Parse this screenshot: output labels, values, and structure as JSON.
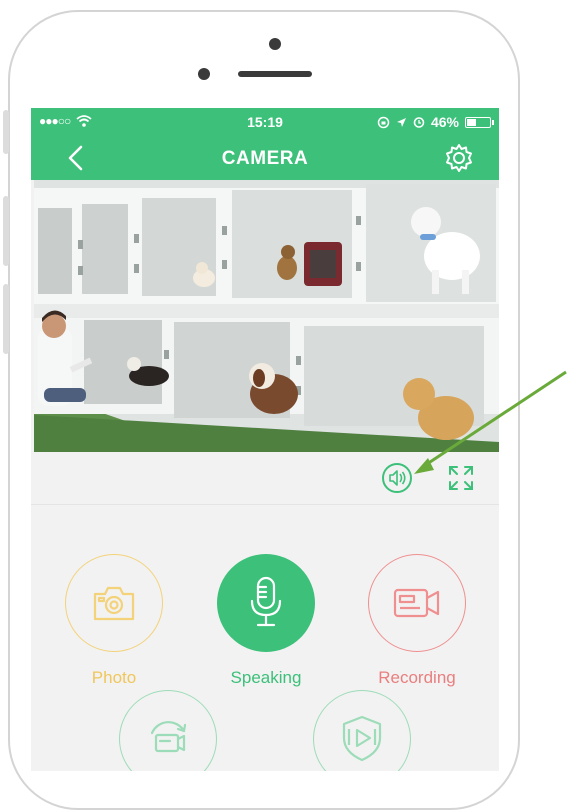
{
  "status_bar": {
    "signal": "●●●○○",
    "time": "15:19",
    "battery": "46%"
  },
  "nav": {
    "title": "CAMERA"
  },
  "actions": [
    {
      "label": "Photo",
      "color": "#f3d27a",
      "icon": "camera-icon"
    },
    {
      "label": "Speaking",
      "color": "#3cc07a",
      "icon": "microphone-icon"
    },
    {
      "label": "Recording",
      "color": "#ef8f8f",
      "icon": "video-recorder-icon"
    },
    {
      "label": "",
      "color": "#9ddcb8",
      "icon": "rotate-camera-icon"
    },
    {
      "label": "",
      "color": "#9ddcb8",
      "icon": "video-playback-icon"
    }
  ],
  "colors": {
    "brand_green": "#3cc07a",
    "annotation_arrow": "#6aaa3a"
  }
}
